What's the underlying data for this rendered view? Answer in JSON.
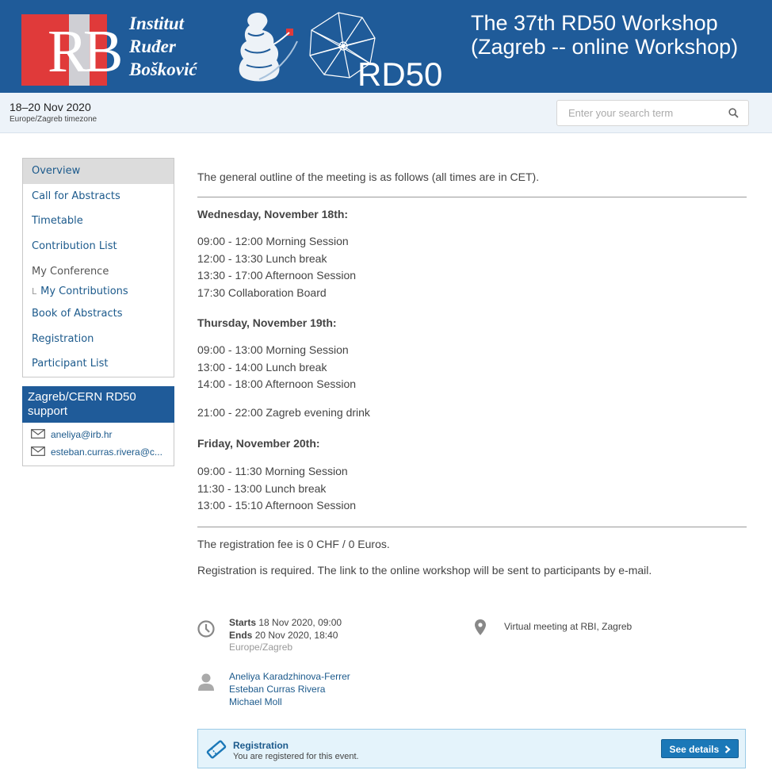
{
  "header": {
    "institute_lines": [
      "Institut",
      "Ruđer",
      "Bošković"
    ],
    "logo_letters": "RB",
    "rd50_logo_text": "RD50",
    "title_line1": "The 37th RD50 Workshop",
    "title_line2": "(Zagreb -- online Workshop)"
  },
  "infobar": {
    "dates": "18–20 Nov 2020",
    "timezone": "Europe/Zagreb timezone",
    "search_placeholder": "Enter your search term"
  },
  "menu": {
    "items": [
      {
        "label": "Overview"
      },
      {
        "label": "Call for Abstracts"
      },
      {
        "label": "Timetable"
      },
      {
        "label": "Contribution List"
      },
      {
        "label": "My Conference"
      },
      {
        "label": "My Contributions"
      },
      {
        "label": "Book of Abstracts"
      },
      {
        "label": "Registration"
      },
      {
        "label": "Participant List"
      }
    ],
    "sub_bracket": "L"
  },
  "support": {
    "title": "Zagreb/CERN RD50 support",
    "emails": [
      "aneliya@irb.hr",
      "esteban.curras.rivera@c..."
    ]
  },
  "content": {
    "intro": "The general outline of the meeting is as follows (all times are in CET).",
    "days": [
      {
        "heading": "Wednesday, November 18th:",
        "lines": [
          "09:00 - 12:00 Morning Session",
          "12:00 - 13:30 Lunch break",
          "13:30 - 17:00 Afternoon Session",
          "17:30 Collaboration Board"
        ]
      },
      {
        "heading": "Thursday, November 19th:",
        "lines": [
          "09:00 - 13:00 Morning Session",
          "13:00 - 14:00 Lunch break",
          "14:00 - 18:00 Afternoon Session"
        ],
        "extra": "21:00 - 22:00 Zagreb evening drink"
      },
      {
        "heading": "Friday, November 20th:",
        "lines": [
          "09:00 - 11:30 Morning Session",
          "11:30 - 13:00 Lunch break",
          "13:00 - 15:10 Afternoon Session"
        ]
      }
    ],
    "fee": "The registration fee is 0 CHF / 0 Euros.",
    "required": "Registration is required. The link to the online workshop will be sent to participants by e-mail."
  },
  "event": {
    "starts_label": "Starts",
    "starts_value": "18 Nov 2020, 09:00",
    "ends_label": "Ends",
    "ends_value": "20 Nov 2020, 18:40",
    "timezone": "Europe/Zagreb",
    "location": "Virtual meeting at RBI, Zagreb",
    "chairs": [
      "Aneliya Karadzhinova-Ferrer",
      "Esteban Curras Rivera",
      "Michael Moll"
    ]
  },
  "registration": {
    "title": "Registration",
    "status": "You are registered for this event.",
    "button": "See details"
  },
  "colors": {
    "header_blue": "#1f5b99",
    "link_blue": "#1c5a8c",
    "logo_red": "#e03a3a",
    "button_blue": "#1b78b8"
  }
}
